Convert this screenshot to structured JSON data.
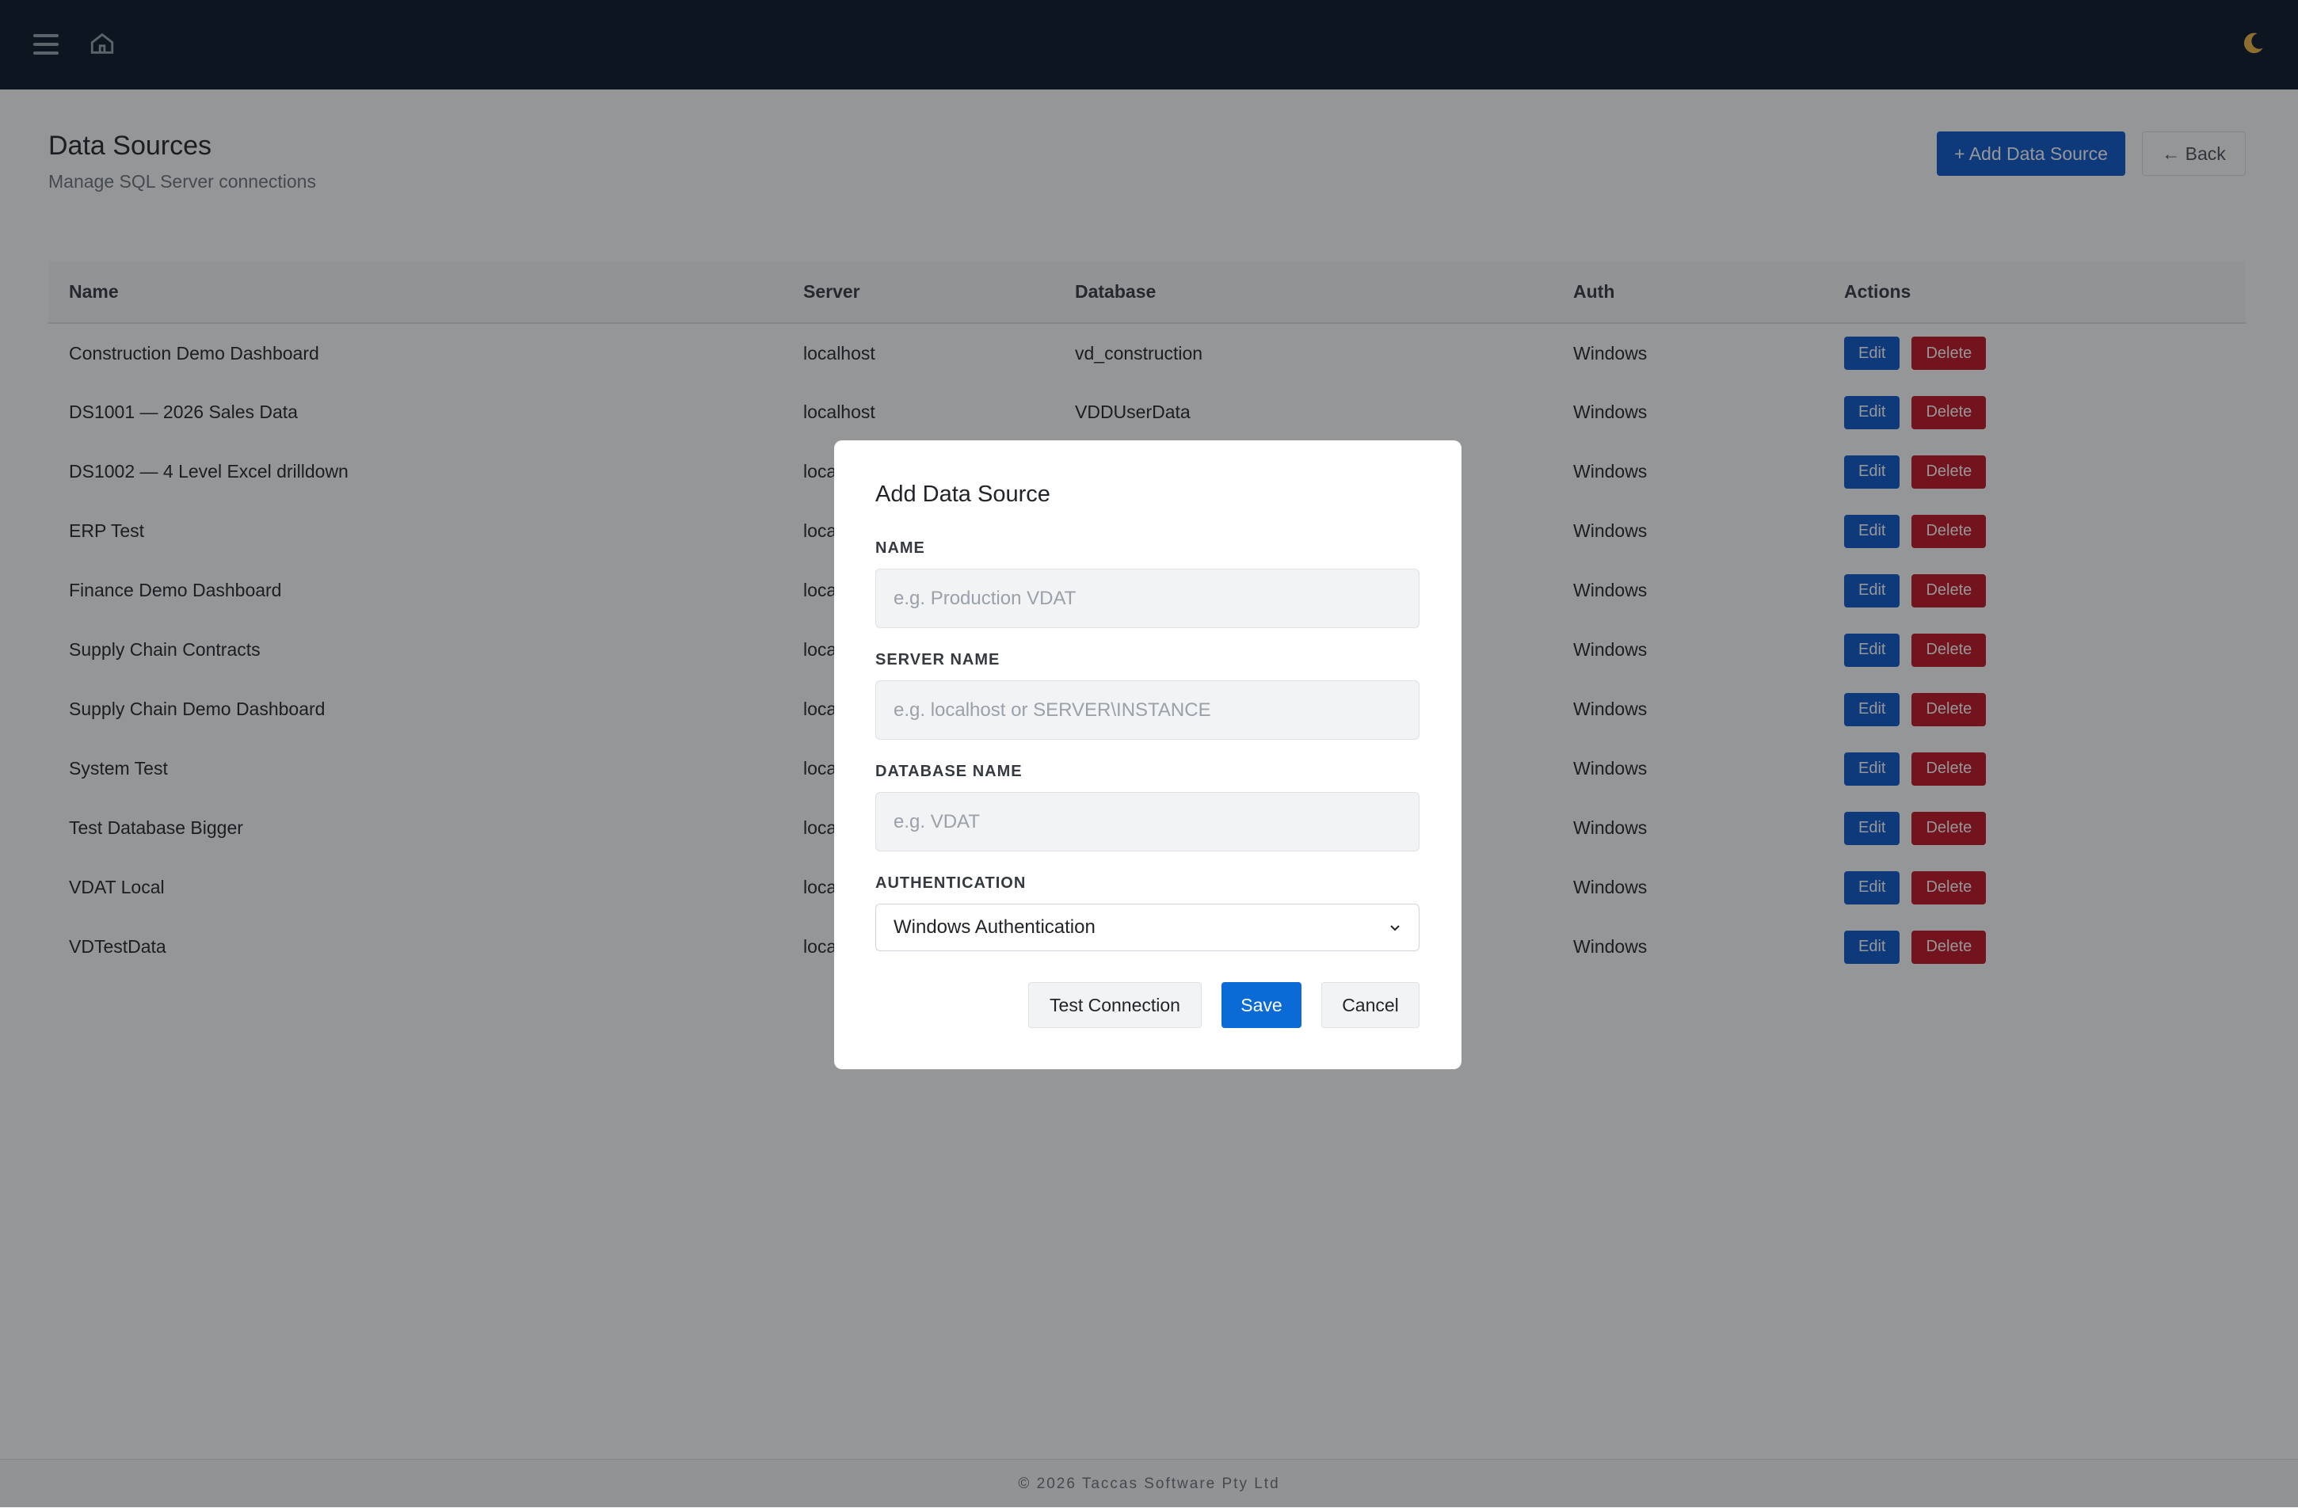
{
  "header": {
    "menu_icon": "hamburger-icon",
    "home_icon": "home-icon",
    "theme_icon": "moon-icon"
  },
  "page": {
    "title": "Data Sources",
    "subtitle": "Manage SQL Server connections",
    "add_button": "+ Add Data Source",
    "back_button": "← Back"
  },
  "table": {
    "headers": [
      "Name",
      "Server",
      "Database",
      "Auth",
      "Actions"
    ],
    "edit_label": "Edit",
    "delete_label": "Delete",
    "rows": [
      {
        "name": "Construction Demo Dashboard",
        "server": "localhost",
        "database": "vd_construction",
        "auth": "Windows"
      },
      {
        "name": "DS1001 — 2026 Sales Data",
        "server": "localhost",
        "database": "VDDUserData",
        "auth": "Windows"
      },
      {
        "name": "DS1002 — 4 Level Excel drilldown",
        "server": "loca",
        "database": "",
        "auth": "Windows"
      },
      {
        "name": "ERP Test",
        "server": "loca",
        "database": "",
        "auth": "Windows"
      },
      {
        "name": "Finance Demo Dashboard",
        "server": "loca",
        "database": "",
        "auth": "Windows"
      },
      {
        "name": "Supply Chain Contracts",
        "server": "loca",
        "database": "",
        "auth": "Windows"
      },
      {
        "name": "Supply Chain Demo Dashboard",
        "server": "loca",
        "database": "",
        "auth": "Windows"
      },
      {
        "name": "System Test",
        "server": "loca",
        "database": "",
        "auth": "Windows"
      },
      {
        "name": "Test Database Bigger",
        "server": "loca",
        "database": "",
        "auth": "Windows"
      },
      {
        "name": "VDAT Local",
        "server": "loca",
        "database": "",
        "auth": "Windows"
      },
      {
        "name": "VDTestData",
        "server": "loca",
        "database": "",
        "auth": "Windows"
      }
    ]
  },
  "modal": {
    "title": "Add Data Source",
    "name_label": "NAME",
    "name_placeholder": "e.g. Production VDAT",
    "server_label": "SERVER NAME",
    "server_placeholder": "e.g. localhost or SERVER\\INSTANCE",
    "database_label": "DATABASE NAME",
    "database_placeholder": "e.g. VDAT",
    "auth_label": "AUTHENTICATION",
    "auth_value": "Windows Authentication",
    "test_button": "Test Connection",
    "save_button": "Save",
    "cancel_button": "Cancel"
  },
  "footer": {
    "text": "© 2026 Taccas Software Pty Ltd"
  },
  "colors": {
    "topbar": "#061426",
    "primary": "#0a58ca",
    "danger": "#c1121f"
  }
}
